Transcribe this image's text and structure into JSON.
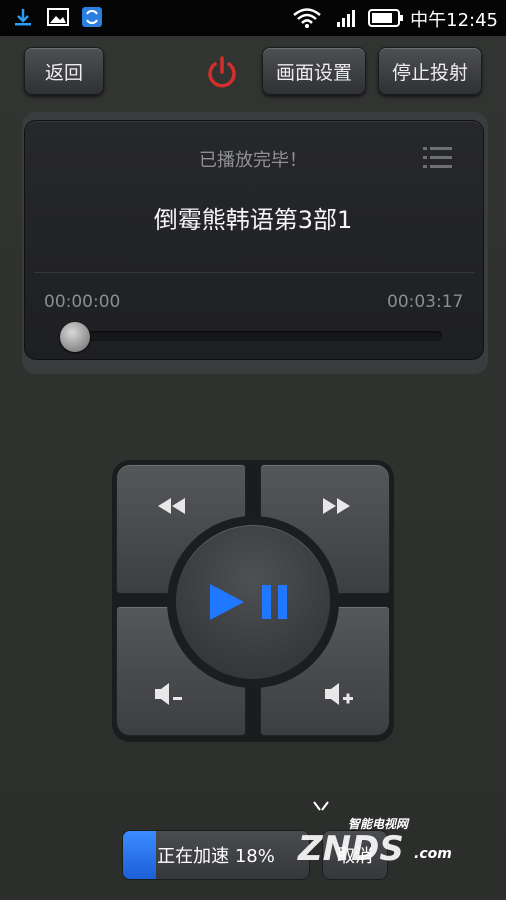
{
  "status_bar": {
    "time": "中午12:45",
    "icons": [
      "download-icon",
      "image-icon",
      "app-notification-icon",
      "wifi-icon",
      "signal-icon",
      "battery-icon"
    ]
  },
  "toolbar": {
    "back_label": "返回",
    "power_icon": "power-icon",
    "picture_settings_label": "画面设置",
    "stop_cast_label": "停止投射"
  },
  "player": {
    "status": "已播放完毕！",
    "title": "倒霉熊韩语第3部1",
    "elapsed": "00:00:00",
    "duration": "00:03:17",
    "seek_progress": 0,
    "list_icon": "playlist-icon"
  },
  "controls": {
    "rewind_icon": "rewind-icon",
    "fast_forward_icon": "fast-forward-icon",
    "play_pause_icon": "play-pause-icon",
    "volume_down_icon": "volume-down-icon",
    "volume_up_icon": "volume-up-icon"
  },
  "accelerate": {
    "label": "正在加速 18%",
    "progress_percent": 18,
    "cancel_label": "取消"
  },
  "watermark": {
    "tagline": "智能电视网",
    "brand": "ZNDS",
    "suffix": ".com"
  },
  "colors": {
    "accent_blue": "#1f78ff",
    "power_red": "#d4302b",
    "background": "#2f312f"
  }
}
